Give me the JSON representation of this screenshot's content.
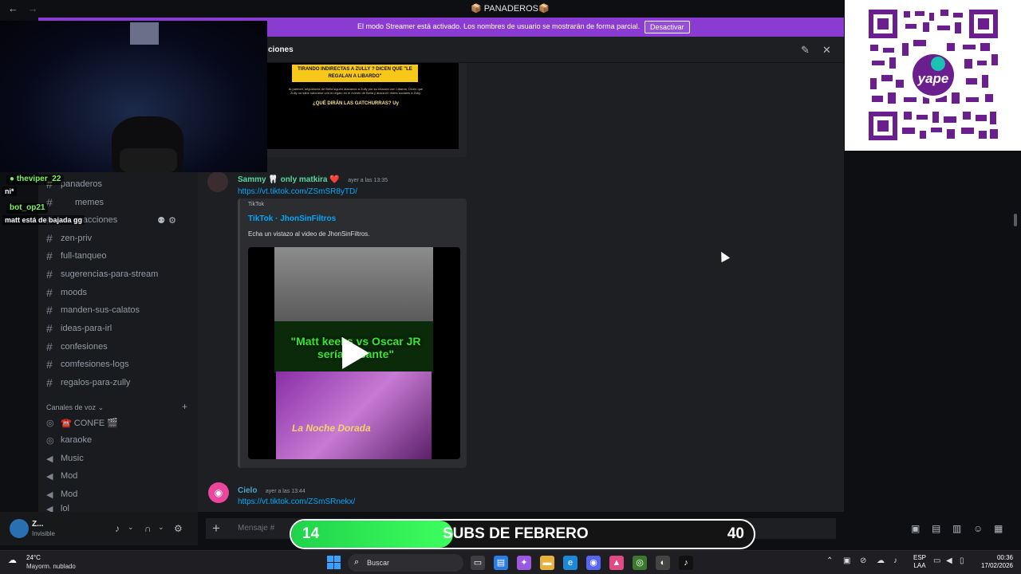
{
  "window": {
    "back_icon": "arrow-left-icon",
    "forward_icon": "arrow-right-icon",
    "title": "📦 PANADEROS📦"
  },
  "banner": {
    "text": "El modo Streamer está activado. Los nombres de usuario se mostrarán de forma parcial.",
    "button": "Desactivar"
  },
  "header": {
    "channel_name": "ciones",
    "icons": [
      "pin-icon",
      "mute-icon"
    ]
  },
  "sidebar": {
    "text_channels": [
      {
        "name": "panaderos"
      },
      {
        "name": "memes"
      },
      {
        "name": "reacciones"
      },
      {
        "name": "zen-priv"
      },
      {
        "name": "full-tanqueo"
      },
      {
        "name": "sugerencias-para-stream"
      },
      {
        "name": "moods"
      },
      {
        "name": "manden-sus-calatos"
      },
      {
        "name": "ideas-para-irl"
      },
      {
        "name": "confesiones"
      },
      {
        "name": "comfesiones-logs"
      },
      {
        "name": "regalos-para-zully"
      }
    ],
    "voice_category": "Canales de voz",
    "voice_channels": [
      {
        "name": "☎️ CONFE 🎬"
      },
      {
        "name": "karaoke"
      },
      {
        "name": "Music"
      },
      {
        "name": "Mod"
      },
      {
        "name": "Mod"
      },
      {
        "name": "lol"
      }
    ]
  },
  "messages": [
    {
      "author": "Sammy 🦷 only matkira ❤️",
      "time": "ayer a las 13:35",
      "link": "https://vt.tiktok.com/ZSmSR8yTD/",
      "embed": {
        "provider": "TikTok",
        "title": "TikTok · JhonSinFiltros",
        "description": "Echa un vistazo al video de JhonSinFiltros.",
        "video_caption": "\"Matt keeks vs Oscar JR sería bacante\"",
        "video_label": "La Noche Dorada"
      }
    },
    {
      "author": "Cielo",
      "time": "ayer a las 13:44",
      "link": "https://vt.tiktok.com/ZSmSRnekx/"
    }
  ],
  "top_embed": {
    "headline": "TIRANDO INDIRECTAS A ZULLY ? DICEN QUE \"LE REGALAN A LIBARDO\"",
    "body": "Al parecer, seguidoras de Bella siguen atacando a Zully por su relación con Libardo. Dicen que Zully no sabe valorarse con el regalo en el evento de Bella y ataca en redes sociales a Zully.",
    "question": "¿QUÉ DIRÁN LAS GATCHURRAS? Uy"
  },
  "composer": {
    "placeholder": "Mensaje #"
  },
  "user_panel": {
    "name": "Z...",
    "status": "Invisible"
  },
  "chat_overlay": [
    {
      "user": "theviper_22",
      "message": "ni*"
    },
    {
      "user": "bot_op21",
      "message": "matt está de bajada gg"
    }
  ],
  "subs_goal": {
    "current": "14",
    "label": "SUBS DE FEBRERO",
    "target": "40",
    "progress": 0.35
  },
  "qr": {
    "brand": "yape"
  },
  "taskbar": {
    "temperature": "24°C",
    "weather": "Mayorm. nublado",
    "search": "Buscar",
    "lang_top": "ESP",
    "lang_bottom": "LAA",
    "time": "00:36",
    "date": "17/02/2026"
  }
}
